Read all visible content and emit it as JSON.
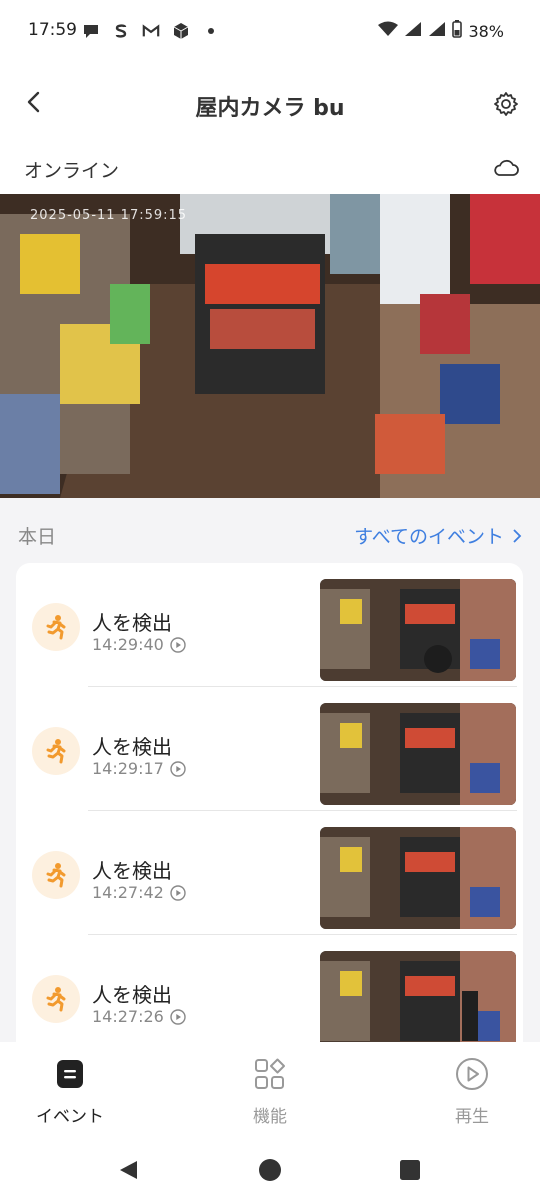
{
  "status_bar": {
    "time": "17:59",
    "battery": "38%",
    "notification_icons": [
      "chat-bubble-icon",
      "s-app-icon",
      "gmail-icon",
      "app-cube-icon",
      "dot-icon"
    ]
  },
  "header": {
    "title": "屋内カメラ bu",
    "status": "オンライン"
  },
  "live_view": {
    "timestamp": "2025-05-11 17:59:15"
  },
  "section": {
    "today_label": "本日",
    "all_events_label": "すべてのイベント"
  },
  "events": [
    {
      "type": "人を検出",
      "time": "14:29:40"
    },
    {
      "type": "人を検出",
      "time": "14:29:17"
    },
    {
      "type": "人を検出",
      "time": "14:27:42"
    },
    {
      "type": "人を検出",
      "time": "14:27:26"
    }
  ],
  "bottom_nav": {
    "items": [
      {
        "label": "イベント",
        "active": true
      },
      {
        "label": "機能",
        "active": false
      },
      {
        "label": "再生",
        "active": false
      }
    ]
  },
  "colors": {
    "accent": "#3f7fe0",
    "event_badge_bg": "#fdf0df",
    "event_icon": "#f29a2e"
  }
}
